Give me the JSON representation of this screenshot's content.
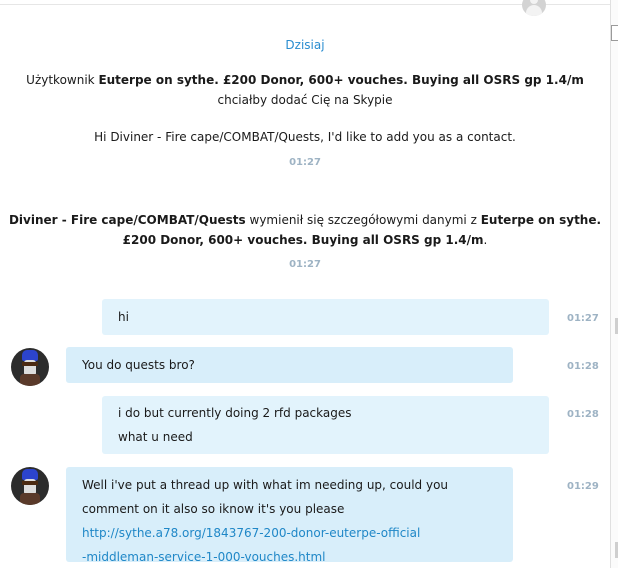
{
  "date_label": "Dzisiaj",
  "system_messages": [
    {
      "prefix": "Użytkownik ",
      "name": "Euterpe on sythe.  £200 Donor, 600+ vouches. Buying all OSRS gp 1.4/m",
      "suffix": " chciałby dodać Cię na Skypie"
    },
    {
      "text": "Hi Diviner - Fire cape/COMBAT/Quests, I'd like to add you as a contact.",
      "time": "01:27"
    },
    {
      "name1": "Diviner - Fire cape/COMBAT/Quests",
      "middle": " wymienił się szczegółowymi danymi z ",
      "name2": "Euterpe on sythe. £200 Donor, 600+ vouches. Buying all OSRS gp 1.4/m",
      "end": ".",
      "time": "01:27"
    }
  ],
  "messages": [
    {
      "from": "me",
      "lines": [
        "hi"
      ],
      "time": "01:27"
    },
    {
      "from": "contact",
      "lines": [
        "You do quests bro?"
      ],
      "time": "01:28"
    },
    {
      "from": "me",
      "lines": [
        "i do but currently doing 2 rfd packages",
        "what u need"
      ],
      "time": "01:28"
    },
    {
      "from": "contact",
      "lines": [
        "Well i've put a thread up with what im needing up, could you",
        "comment on it also so iknow it's you please"
      ],
      "link_lines": [
        "http://sythe.a78.org/1843767-200-donor-euterpe-official",
        "-middleman-service-1-000-vouches.html"
      ],
      "time": "01:29"
    }
  ],
  "colors": {
    "contact_bubble": "#d8eefa",
    "my_bubble": "#e2f3fc",
    "date_label": "#2a8dd0",
    "timestamp": "#9eb3c4",
    "link": "#1f87c7"
  },
  "icons": {
    "top_avatar": "user-avatar-placeholder-icon",
    "contact_avatar": "wizard-avatar-icon"
  }
}
